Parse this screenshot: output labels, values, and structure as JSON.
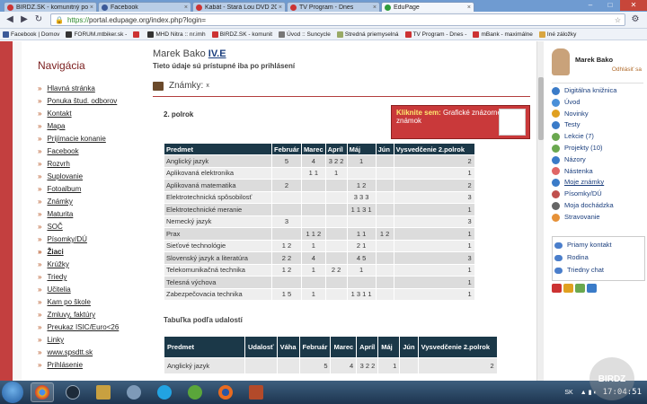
{
  "browser": {
    "tabs": [
      {
        "label": "BIRDZ.SK - komunitný port",
        "color": "#c33",
        "active": false
      },
      {
        "label": "Facebook",
        "color": "#3b5998",
        "active": false
      },
      {
        "label": "Kabát - Stará Lou DVD 2011",
        "color": "#c33",
        "active": false
      },
      {
        "label": "TV Program - Dnes",
        "color": "#c33",
        "active": false
      },
      {
        "label": "EduPage",
        "color": "#2f9c3b",
        "active": true
      }
    ],
    "url_scheme": "https://",
    "url": "portal.edupage.org/index.php?login=",
    "bookmarks": [
      {
        "label": "Facebook | Domov",
        "color": "#3b5998"
      },
      {
        "label": "FORUM.mtbiker.sk -",
        "color": "#333"
      },
      {
        "label": "",
        "color": "#c33"
      },
      {
        "label": "MHD Nitra :: nr.imh",
        "color": "#333"
      },
      {
        "label": "BIRDZ.SK - komunit",
        "color": "#c33"
      },
      {
        "label": "Úvod :: Suncycle",
        "color": "#777"
      },
      {
        "label": "Stredná priemyselná",
        "color": "#9a6"
      },
      {
        "label": "TV Program - Dnes -",
        "color": "#c33"
      },
      {
        "label": "mBank - maximálne",
        "color": "#c33"
      },
      {
        "label": "Iné záložky",
        "color": "#d9a640"
      }
    ]
  },
  "nav": {
    "title": "Navigácia",
    "items": [
      "Hlavná stránka",
      "Ponuka štud. odborov",
      "Kontakt",
      "Mapa",
      "Prijímacie konanie",
      "Facebook",
      "Rozvrh",
      "Suplovanie",
      "Fotoalbum",
      "Známky",
      "Maturita",
      "SOČ",
      "Písomky/DÚ",
      "Žiaci",
      "Krúžky",
      "Triedy",
      "Učitelia",
      "Kam po škole",
      "Zmluvy, faktúry",
      "Preukaz ISIC/Euro<26",
      "Linky",
      "www.spsdtt.sk",
      "Prihlásenie"
    ]
  },
  "main": {
    "student_name": "Marek Bako",
    "student_class": "IV.E",
    "login_note": "Tieto údaje sú prístupné iba po prihlásení",
    "section_title": "Známky:",
    "section_close": "x",
    "term": "2. polrok",
    "graph_link_highlight": "Kliknite sem:",
    "graph_link_text": "Grafické znázornenie známok",
    "grades_headers": [
      "Predmet",
      "Február",
      "Marec",
      "Apríl",
      "Máj",
      "Jún",
      "Vysvedčenie 2.polrok"
    ],
    "grades_rows": [
      [
        "Anglický jazyk",
        "5",
        "4",
        "3 2 2",
        "1",
        "",
        "2"
      ],
      [
        "Aplikovaná elektronika",
        "",
        "1 1",
        "1",
        "",
        "",
        "1"
      ],
      [
        "Aplikovaná matematika",
        "2",
        "",
        "",
        "1 2",
        "",
        "2"
      ],
      [
        "Elektrotechnická spôsobilosť",
        "",
        "",
        "",
        "3 3 3",
        "",
        "3"
      ],
      [
        "Elektrotechnické meranie",
        "",
        "",
        "",
        "1 1 3 1",
        "",
        "1"
      ],
      [
        "Nemecký jazyk",
        "3",
        "",
        "",
        "",
        "",
        "3"
      ],
      [
        "Prax",
        "",
        "1 1 2",
        "",
        "1 1",
        "1 2",
        "1"
      ],
      [
        "Sieťové technológie",
        "1 2",
        "1",
        "",
        "2 1",
        "",
        "1"
      ],
      [
        "Slovenský jazyk a literatúra",
        "2 2",
        "4",
        "",
        "4 5",
        "",
        "3"
      ],
      [
        "Telekomunikačná technika",
        "1 2",
        "1",
        "2 2",
        "1",
        "",
        "1"
      ],
      [
        "Telesná výchova",
        "",
        "",
        "",
        "",
        "",
        "1"
      ],
      [
        "Zabezpečovacia technika",
        "1 5",
        "1",
        "",
        "1 3 1 1",
        "",
        "1"
      ]
    ],
    "events_title": "Tabuľka podľa udalostí",
    "events_headers": [
      "Predmet",
      "Udalosť",
      "Váha",
      "Február",
      "Marec",
      "Apríl",
      "Máj",
      "Jún",
      "Vysvedčenie 2.polrok"
    ],
    "events_rows": [
      [
        "Anglický jazyk",
        "",
        "",
        "5",
        "4",
        "3 2 2",
        "1",
        "",
        "2"
      ]
    ]
  },
  "sidebar": {
    "user_name": "Marek Bako",
    "logout": "Odhlásiť sa",
    "menu": [
      {
        "label": "Digitálna knižnica",
        "color": "#3a7bc8"
      },
      {
        "label": "Úvod",
        "color": "#4a90d9"
      },
      {
        "label": "Novinky",
        "color": "#e0a020"
      },
      {
        "label": "Testy",
        "color": "#3a7bc8"
      },
      {
        "label": "Lekcie (7)",
        "color": "#6aa84f"
      },
      {
        "label": "Projekty (10)",
        "color": "#6aa84f"
      },
      {
        "label": "Názory",
        "color": "#3a7bc8"
      },
      {
        "label": "Nástenka",
        "color": "#e06666"
      },
      {
        "label": "Moje známky",
        "color": "#3a7bc8"
      },
      {
        "label": "Písomky/DÚ",
        "color": "#c0504d"
      },
      {
        "label": "Moja dochádzka",
        "color": "#666666"
      },
      {
        "label": "Stravovanie",
        "color": "#e69138"
      }
    ],
    "contacts": [
      "Priamy kontakt",
      "Rodina",
      "Triedny chat"
    ]
  },
  "taskbar": {
    "lang": "SK",
    "clock": "17:04:51",
    "watermark": "BIRDZ"
  }
}
